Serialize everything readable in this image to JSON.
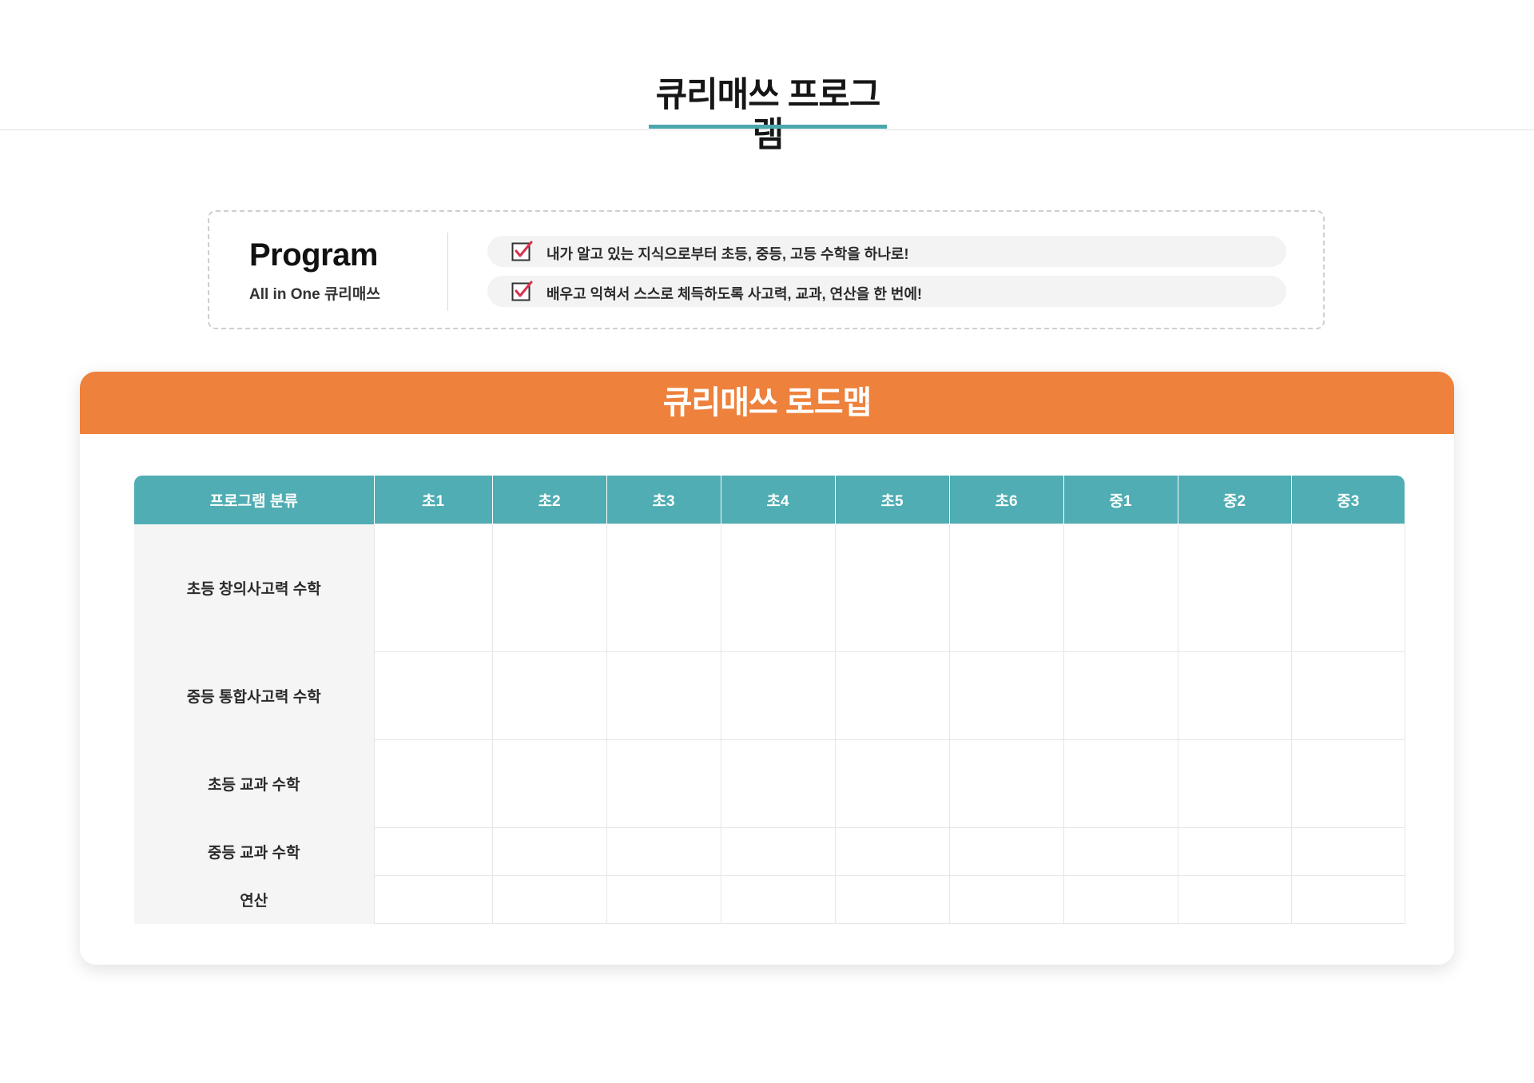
{
  "header": {
    "title": "큐리매쓰 프로그램"
  },
  "program": {
    "heading": "Program",
    "subheading": "All in One 큐리매쓰",
    "points": [
      {
        "icon": "checkbox-checked-icon",
        "text": "내가 알고 있는 지식으로부터 초등, 중등, 고등 수학을 하나로!"
      },
      {
        "icon": "checkbox-checked-icon",
        "text": "배우고 익혀서 스스로 체득하도록 사고력, 교과, 연산을 한 번에!"
      }
    ]
  },
  "roadmap": {
    "title": "큐리매쓰 로드맵",
    "columns": [
      "프로그램 분류",
      "초1",
      "초2",
      "초3",
      "초4",
      "초5",
      "초6",
      "중1",
      "중2",
      "중3"
    ],
    "rows": [
      {
        "label": "초등 창의사고력 수학"
      },
      {
        "label": "중등 통합사고력 수학"
      },
      {
        "label": "초등 교과 수학"
      },
      {
        "label": "중등 교과 수학"
      },
      {
        "label": "연산"
      }
    ]
  },
  "colors": {
    "accent_teal": "#4fadb3",
    "header_orange": "#ee813b",
    "check_red": "#d9304f"
  }
}
